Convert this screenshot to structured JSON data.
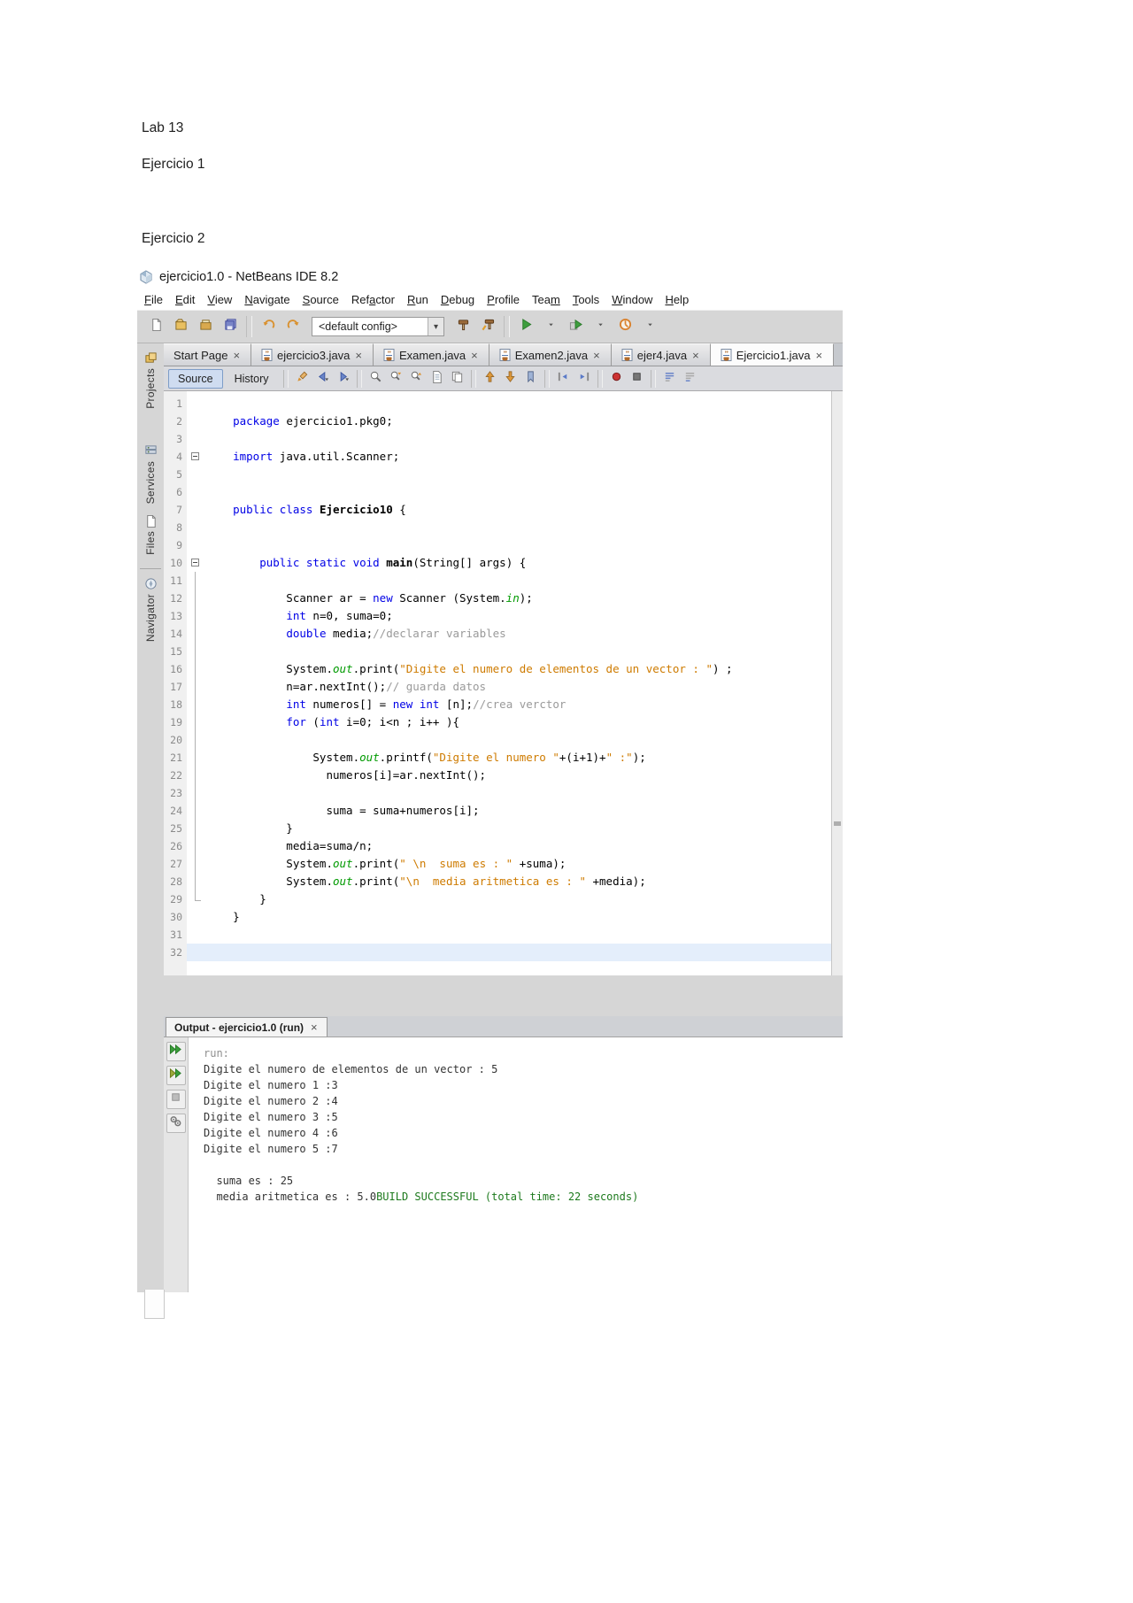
{
  "document": {
    "lab_title": "Lab 13",
    "exercise1": "Ejercicio 1",
    "exercise2": "Ejercicio 2"
  },
  "colors": {
    "keyword": "#0000e6",
    "string": "#ce7b00",
    "comment": "#9a9a9a",
    "static_field": "#009a00",
    "build_success": "#1d7a1d",
    "run_green": "#3f9e3f",
    "current_line_highlight": "#e4eefb"
  },
  "ide": {
    "window_title": "ejercicio1.0 - NetBeans IDE 8.2",
    "menu": {
      "items": [
        {
          "label": "File",
          "u": 0
        },
        {
          "label": "Edit",
          "u": 0
        },
        {
          "label": "View",
          "u": 0
        },
        {
          "label": "Navigate",
          "u": 0
        },
        {
          "label": "Source",
          "u": 0
        },
        {
          "label": "Refactor",
          "u": 3
        },
        {
          "label": "Run",
          "u": 0
        },
        {
          "label": "Debug",
          "u": 0
        },
        {
          "label": "Profile",
          "u": 0
        },
        {
          "label": "Team",
          "u": 3
        },
        {
          "label": "Tools",
          "u": 0
        },
        {
          "label": "Window",
          "u": 0
        },
        {
          "label": "Help",
          "u": 0
        }
      ]
    },
    "toolbar": {
      "config_value": "<default config>",
      "icons_left": [
        "new-file-icon",
        "new-project-icon",
        "open-project-icon",
        "save-all-icon",
        "|",
        "undo-icon",
        "redo-icon"
      ],
      "icons_right": [
        "build-project-icon",
        "clean-build-icon",
        "|",
        "run-project-icon",
        "chevron-down-icon",
        "debug-project-icon",
        "chevron-down-icon",
        "profile-project-icon",
        "chevron-down-icon"
      ]
    },
    "sidebar": {
      "items": [
        {
          "label": "Projects",
          "icon": "projects-icon"
        },
        {
          "label": "Services",
          "icon": "services-icon"
        },
        {
          "label": "Files",
          "icon": "files-icon"
        },
        {
          "label": "Navigator",
          "icon": "navigator-icon",
          "divider": true
        }
      ]
    },
    "tabs": [
      {
        "label": "Start Page",
        "icon": false,
        "selected": false
      },
      {
        "label": "ejercicio3.java",
        "icon": true,
        "selected": false
      },
      {
        "label": "Examen.java",
        "icon": true,
        "selected": false
      },
      {
        "label": "Examen2.java",
        "icon": true,
        "selected": false
      },
      {
        "label": "ejer4.java",
        "icon": true,
        "selected": false
      },
      {
        "label": "Ejercicio1.java",
        "icon": true,
        "selected": true
      }
    ],
    "editor_toolbar": {
      "source_label": "Source",
      "history_label": "History",
      "icons": [
        "last-edit-icon",
        "back-icon",
        "forward-icon",
        "|",
        "find-selection-icon",
        "find-next-icon",
        "find-previous-icon",
        "select-in-projects-icon",
        "clipboard-history-icon",
        "|",
        "previous-bookmark-icon",
        "next-bookmark-icon",
        "toggle-bookmark-icon",
        "|",
        "shift-left-icon",
        "shift-right-icon",
        "|",
        "start-macro-icon",
        "stop-macro-icon",
        "|",
        "comment-icon",
        "uncomment-icon"
      ]
    },
    "editor": {
      "current_line": 32,
      "lines": [
        {
          "n": 1
        },
        {
          "n": 2,
          "seg": [
            {
              "t": "    "
            },
            {
              "t": "package",
              "c": "k"
            },
            {
              "t": " ejercicio1.pkg0;"
            }
          ]
        },
        {
          "n": 3
        },
        {
          "n": 4,
          "fold": "box",
          "seg": [
            {
              "t": "    "
            },
            {
              "t": "import",
              "c": "k"
            },
            {
              "t": " java.util.Scanner;"
            }
          ]
        },
        {
          "n": 5
        },
        {
          "n": 6
        },
        {
          "n": 7,
          "seg": [
            {
              "t": "    "
            },
            {
              "t": "public",
              "c": "k"
            },
            {
              "t": " "
            },
            {
              "t": "class",
              "c": "k"
            },
            {
              "t": " "
            },
            {
              "t": "Ejercicio10",
              "c": "b"
            },
            {
              "t": " {"
            }
          ]
        },
        {
          "n": 8
        },
        {
          "n": 9
        },
        {
          "n": 10,
          "fold": "box",
          "seg": [
            {
              "t": "        "
            },
            {
              "t": "public",
              "c": "k"
            },
            {
              "t": " "
            },
            {
              "t": "static",
              "c": "k"
            },
            {
              "t": " "
            },
            {
              "t": "void",
              "c": "k"
            },
            {
              "t": " "
            },
            {
              "t": "main",
              "c": "b"
            },
            {
              "t": "(String[] args) {"
            }
          ]
        },
        {
          "n": 11,
          "fold": "line"
        },
        {
          "n": 12,
          "fold": "line",
          "seg": [
            {
              "t": "            Scanner ar = "
            },
            {
              "t": "new",
              "c": "k"
            },
            {
              "t": " Scanner (System."
            },
            {
              "t": "in",
              "c": "f"
            },
            {
              "t": ");"
            }
          ]
        },
        {
          "n": 13,
          "fold": "line",
          "seg": [
            {
              "t": "            "
            },
            {
              "t": "int",
              "c": "k"
            },
            {
              "t": " n=0, suma=0;"
            }
          ]
        },
        {
          "n": 14,
          "fold": "line",
          "seg": [
            {
              "t": "            "
            },
            {
              "t": "double",
              "c": "k"
            },
            {
              "t": " media;"
            },
            {
              "t": "//declarar variables",
              "c": "c"
            }
          ]
        },
        {
          "n": 15,
          "fold": "line"
        },
        {
          "n": 16,
          "fold": "line",
          "seg": [
            {
              "t": "            System."
            },
            {
              "t": "out",
              "c": "f"
            },
            {
              "t": ".print("
            },
            {
              "t": "\"Digite el numero de elementos de un vector : \"",
              "c": "s"
            },
            {
              "t": ") ;"
            }
          ]
        },
        {
          "n": 17,
          "fold": "line",
          "seg": [
            {
              "t": "            n=ar.nextInt();"
            },
            {
              "t": "// guarda datos",
              "c": "c"
            }
          ]
        },
        {
          "n": 18,
          "fold": "line",
          "seg": [
            {
              "t": "            "
            },
            {
              "t": "int",
              "c": "k"
            },
            {
              "t": " numeros[] = "
            },
            {
              "t": "new",
              "c": "k"
            },
            {
              "t": " "
            },
            {
              "t": "int",
              "c": "k"
            },
            {
              "t": " [n];"
            },
            {
              "t": "//crea verctor",
              "c": "c"
            }
          ]
        },
        {
          "n": 19,
          "fold": "line",
          "seg": [
            {
              "t": "            "
            },
            {
              "t": "for",
              "c": "k"
            },
            {
              "t": " ("
            },
            {
              "t": "int",
              "c": "k"
            },
            {
              "t": " i=0; i<n ; i++ ){"
            }
          ]
        },
        {
          "n": 20,
          "fold": "line"
        },
        {
          "n": 21,
          "fold": "line",
          "seg": [
            {
              "t": "                System."
            },
            {
              "t": "out",
              "c": "f"
            },
            {
              "t": ".printf("
            },
            {
              "t": "\"Digite el numero \"",
              "c": "s"
            },
            {
              "t": "+(i+1)+"
            },
            {
              "t": "\" :\"",
              "c": "s"
            },
            {
              "t": ");"
            }
          ]
        },
        {
          "n": 22,
          "fold": "line",
          "seg": [
            {
              "t": "                  numeros[i]=ar.nextInt();"
            }
          ]
        },
        {
          "n": 23,
          "fold": "line"
        },
        {
          "n": 24,
          "fold": "line",
          "seg": [
            {
              "t": "                  suma = suma+numeros[i];"
            }
          ]
        },
        {
          "n": 25,
          "fold": "line",
          "seg": [
            {
              "t": "            }"
            }
          ]
        },
        {
          "n": 26,
          "fold": "line",
          "seg": [
            {
              "t": "            media=suma/n;"
            }
          ]
        },
        {
          "n": 27,
          "fold": "line",
          "seg": [
            {
              "t": "            System."
            },
            {
              "t": "out",
              "c": "f"
            },
            {
              "t": ".print("
            },
            {
              "t": "\" \\n  suma es : \"",
              "c": "s"
            },
            {
              "t": " +suma);"
            }
          ]
        },
        {
          "n": 28,
          "fold": "line",
          "seg": [
            {
              "t": "            System."
            },
            {
              "t": "out",
              "c": "f"
            },
            {
              "t": ".print("
            },
            {
              "t": "\"\\n  media aritmetica es : \"",
              "c": "s"
            },
            {
              "t": " +media);"
            }
          ]
        },
        {
          "n": 29,
          "fold": "corner",
          "seg": [
            {
              "t": "        }"
            }
          ]
        },
        {
          "n": 30,
          "seg": [
            {
              "t": "    }"
            }
          ]
        },
        {
          "n": 31
        },
        {
          "n": 32,
          "highlight": true
        }
      ]
    },
    "output": {
      "tab_label": "Output - ejercicio1.0 (run)",
      "icons": [
        "rerun-icon",
        "rerun-debug-icon",
        "stop-build-icon",
        "build-settings-icon"
      ],
      "lines": [
        {
          "seg": [
            {
              "t": "run:",
              "c": "muted"
            }
          ]
        },
        {
          "seg": [
            {
              "t": "Digite el numero de elementos de un vector : 5"
            }
          ]
        },
        {
          "seg": [
            {
              "t": "Digite el numero 1 :3"
            }
          ]
        },
        {
          "seg": [
            {
              "t": "Digite el numero 2 :4"
            }
          ]
        },
        {
          "seg": [
            {
              "t": "Digite el numero 3 :5"
            }
          ]
        },
        {
          "seg": [
            {
              "t": "Digite el numero 4 :6"
            }
          ]
        },
        {
          "seg": [
            {
              "t": "Digite el numero 5 :7"
            }
          ]
        },
        {
          "seg": []
        },
        {
          "seg": [
            {
              "t": "  suma es : 25"
            }
          ]
        },
        {
          "seg": [
            {
              "t": "  media aritmetica es : 5.0"
            },
            {
              "t": "BUILD SUCCESSFUL (total time: 22 seconds)",
              "c": "success"
            }
          ]
        }
      ]
    }
  }
}
